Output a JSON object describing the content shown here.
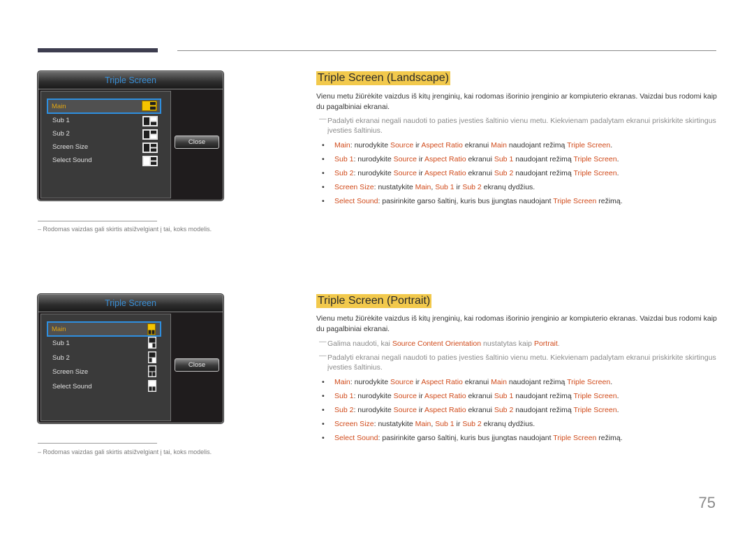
{
  "page_number": "75",
  "colors": {
    "accent": "#d04a1a",
    "heading_highlight": "#f2c94c",
    "osd_title": "#3a8fd6",
    "osd_selected": "#e1a512",
    "osd_focus_border": "#2e8fe0"
  },
  "osd_panels": [
    {
      "title": "Triple Screen",
      "orientation": "landscape",
      "items": [
        {
          "label": "Main",
          "icon": "layout-main-icon",
          "selected": true
        },
        {
          "label": "Sub 1",
          "icon": "layout-sub1-icon",
          "selected": false
        },
        {
          "label": "Sub 2",
          "icon": "layout-sub2-icon",
          "selected": false
        },
        {
          "label": "Screen Size",
          "icon": "layout-screen-size-icon",
          "selected": false
        },
        {
          "label": "Select Sound",
          "icon": "layout-select-sound-icon",
          "selected": false
        }
      ],
      "close_label": "Close"
    },
    {
      "title": "Triple Screen",
      "orientation": "portrait",
      "items": [
        {
          "label": "Main",
          "icon": "layout-main-icon",
          "selected": true
        },
        {
          "label": "Sub 1",
          "icon": "layout-sub1-icon",
          "selected": false
        },
        {
          "label": "Sub 2",
          "icon": "layout-sub2-icon",
          "selected": false
        },
        {
          "label": "Screen Size",
          "icon": "layout-screen-size-icon",
          "selected": false
        },
        {
          "label": "Select Sound",
          "icon": "layout-select-sound-icon",
          "selected": false
        }
      ],
      "close_label": "Close"
    }
  ],
  "footnote": "–  Rodomas vaizdas gali skirtis atsižvelgiant į tai, koks modelis.",
  "sections": [
    {
      "heading": "Triple Screen (Landscape)",
      "intro": "Vienu metu žiūrėkite vaizdus iš kitų įrenginių, kai rodomas išorinio įrenginio ar kompiuterio ekranas. Vaizdai bus rodomi kaip du pagalbiniai ekranai.",
      "notes": [
        [
          {
            "t": "Padalyti ekranai negali naudoti to paties įvesties šaltinio vienu metu. Kiekvienam padalytam ekranui priskirkite skirtingus įvesties šaltinius.",
            "hl": false
          }
        ]
      ],
      "bullets": [
        [
          {
            "t": "Main",
            "hl": true
          },
          {
            "t": ": nurodykite  ",
            "hl": false
          },
          {
            "t": "Source",
            "hl": true
          },
          {
            "t": " ir ",
            "hl": false
          },
          {
            "t": "Aspect Ratio",
            "hl": true
          },
          {
            "t": " ekranui ",
            "hl": false
          },
          {
            "t": "Main",
            "hl": true
          },
          {
            "t": " naudojant režimą ",
            "hl": false
          },
          {
            "t": "Triple Screen",
            "hl": true
          },
          {
            "t": ".",
            "hl": false
          }
        ],
        [
          {
            "t": "Sub 1",
            "hl": true
          },
          {
            "t": ": nurodykite  ",
            "hl": false
          },
          {
            "t": "Source",
            "hl": true
          },
          {
            "t": " ir ",
            "hl": false
          },
          {
            "t": "Aspect Ratio",
            "hl": true
          },
          {
            "t": " ekranui ",
            "hl": false
          },
          {
            "t": "Sub 1",
            "hl": true
          },
          {
            "t": " naudojant režimą ",
            "hl": false
          },
          {
            "t": "Triple Screen",
            "hl": true
          },
          {
            "t": ".",
            "hl": false
          }
        ],
        [
          {
            "t": "Sub 2",
            "hl": true
          },
          {
            "t": ": nurodykite  ",
            "hl": false
          },
          {
            "t": "Source",
            "hl": true
          },
          {
            "t": " ir ",
            "hl": false
          },
          {
            "t": "Aspect Ratio",
            "hl": true
          },
          {
            "t": " ekranui ",
            "hl": false
          },
          {
            "t": "Sub 2",
            "hl": true
          },
          {
            "t": " naudojant režimą ",
            "hl": false
          },
          {
            "t": "Triple Screen",
            "hl": true
          },
          {
            "t": ".",
            "hl": false
          }
        ],
        [
          {
            "t": "Screen Size",
            "hl": true
          },
          {
            "t": ": nustatykite ",
            "hl": false
          },
          {
            "t": "Main",
            "hl": true
          },
          {
            "t": ", ",
            "hl": false
          },
          {
            "t": "Sub 1",
            "hl": true
          },
          {
            "t": " ir ",
            "hl": false
          },
          {
            "t": "Sub 2",
            "hl": true
          },
          {
            "t": " ekranų dydžius.",
            "hl": false
          }
        ],
        [
          {
            "t": "Select Sound",
            "hl": true
          },
          {
            "t": ": pasirinkite garso šaltinį, kuris bus įjungtas naudojant ",
            "hl": false
          },
          {
            "t": "Triple Screen",
            "hl": true
          },
          {
            "t": " režimą.",
            "hl": false
          }
        ]
      ]
    },
    {
      "heading": "Triple Screen (Portrait)",
      "intro": "Vienu metu žiūrėkite vaizdus iš kitų įrenginių, kai rodomas išorinio įrenginio ar kompiuterio ekranas. Vaizdai bus rodomi kaip du pagalbiniai ekranai.",
      "notes": [
        [
          {
            "t": "Galima naudoti, kai ",
            "hl": false
          },
          {
            "t": "Source Content Orientation",
            "hl": true
          },
          {
            "t": " nustatytas kaip ",
            "hl": false
          },
          {
            "t": "Portrait",
            "hl": true
          },
          {
            "t": ".",
            "hl": false
          }
        ],
        [
          {
            "t": "Padalyti ekranai negali naudoti to paties įvesties šaltinio vienu metu. Kiekvienam padalytam ekranui priskirkite skirtingus įvesties šaltinius.",
            "hl": false
          }
        ]
      ],
      "bullets": [
        [
          {
            "t": "Main",
            "hl": true
          },
          {
            "t": ": nurodykite  ",
            "hl": false
          },
          {
            "t": "Source",
            "hl": true
          },
          {
            "t": " ir ",
            "hl": false
          },
          {
            "t": "Aspect Ratio",
            "hl": true
          },
          {
            "t": " ekranui ",
            "hl": false
          },
          {
            "t": "Main",
            "hl": true
          },
          {
            "t": " naudojant režimą ",
            "hl": false
          },
          {
            "t": "Triple Screen",
            "hl": true
          },
          {
            "t": ".",
            "hl": false
          }
        ],
        [
          {
            "t": "Sub 1",
            "hl": true
          },
          {
            "t": ": nurodykite  ",
            "hl": false
          },
          {
            "t": "Source",
            "hl": true
          },
          {
            "t": " ir ",
            "hl": false
          },
          {
            "t": "Aspect Ratio",
            "hl": true
          },
          {
            "t": " ekranui ",
            "hl": false
          },
          {
            "t": "Sub 1",
            "hl": true
          },
          {
            "t": " naudojant režimą ",
            "hl": false
          },
          {
            "t": "Triple Screen",
            "hl": true
          },
          {
            "t": ".",
            "hl": false
          }
        ],
        [
          {
            "t": "Sub 2",
            "hl": true
          },
          {
            "t": ": nurodykite  ",
            "hl": false
          },
          {
            "t": "Source",
            "hl": true
          },
          {
            "t": " ir ",
            "hl": false
          },
          {
            "t": "Aspect Ratio",
            "hl": true
          },
          {
            "t": " ekranui ",
            "hl": false
          },
          {
            "t": "Sub 2",
            "hl": true
          },
          {
            "t": " naudojant režimą ",
            "hl": false
          },
          {
            "t": "Triple Screen",
            "hl": true
          },
          {
            "t": ".",
            "hl": false
          }
        ],
        [
          {
            "t": "Screen Size",
            "hl": true
          },
          {
            "t": ": nustatykite ",
            "hl": false
          },
          {
            "t": "Main",
            "hl": true
          },
          {
            "t": ", ",
            "hl": false
          },
          {
            "t": "Sub 1",
            "hl": true
          },
          {
            "t": " ir ",
            "hl": false
          },
          {
            "t": "Sub 2",
            "hl": true
          },
          {
            "t": " ekranų dydžius.",
            "hl": false
          }
        ],
        [
          {
            "t": "Select Sound",
            "hl": true
          },
          {
            "t": ": pasirinkite garso šaltinį, kuris bus įjungtas naudojant ",
            "hl": false
          },
          {
            "t": "Triple Screen",
            "hl": true
          },
          {
            "t": " režimą.",
            "hl": false
          }
        ]
      ]
    }
  ]
}
